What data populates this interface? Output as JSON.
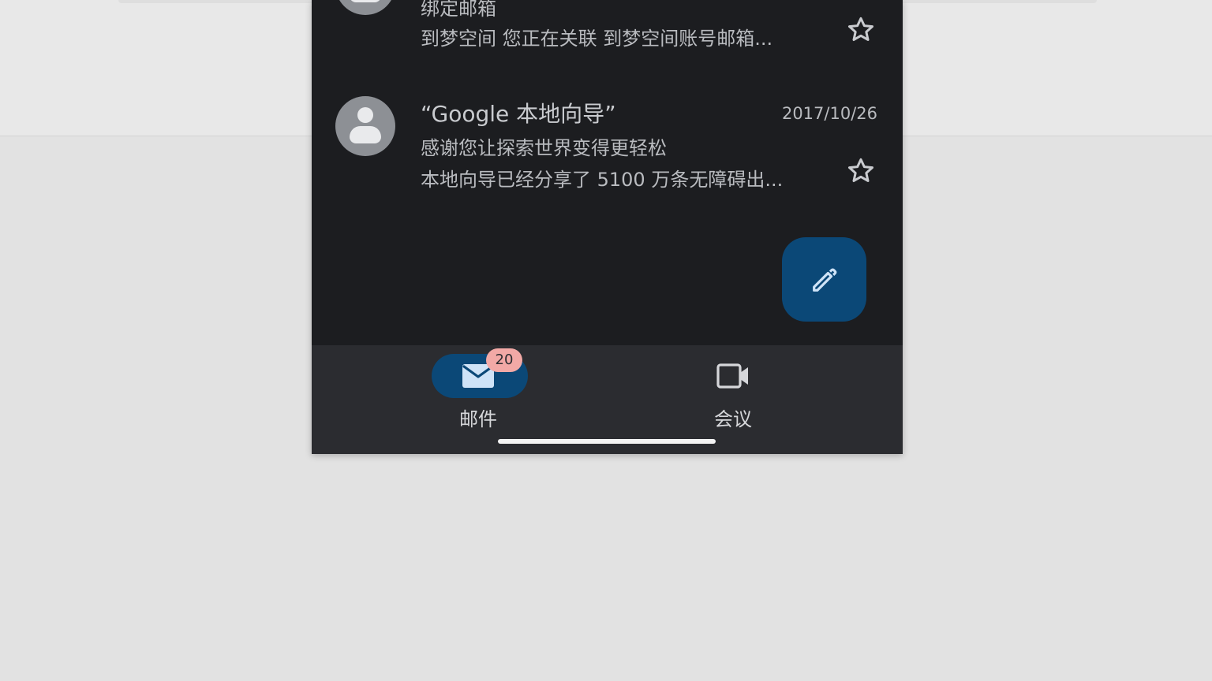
{
  "colors": {
    "page_bg": "#e2e2e2",
    "screen_bg": "#1c1d20",
    "bottom_nav_bg": "#2b2c30",
    "accent": "#0b4877",
    "badge_bg": "#f2a9a6",
    "text_primary": "#c9cbcf",
    "text_secondary": "#b9bbbf"
  },
  "emails": [
    {
      "sender": "",
      "subject": "绑定邮箱",
      "snippet": "到梦空间 您正在关联 到梦空间账号邮箱...",
      "date": "",
      "starred": false,
      "avatar_icon": "person-icon",
      "star_icon": "star-outline-icon"
    },
    {
      "sender": "“Google 本地向导”",
      "subject": "感谢您让探索世界变得更轻松",
      "snippet": "本地向导已经分享了 5100 万条无障碍出...",
      "date": "2017/10/26",
      "starred": false,
      "avatar_icon": "person-icon",
      "star_icon": "star-outline-icon"
    }
  ],
  "compose_fab": {
    "icon": "pencil-icon"
  },
  "bottom_nav": {
    "items": [
      {
        "label": "邮件",
        "icon": "mail-icon",
        "badge": "20",
        "active": true
      },
      {
        "label": "会议",
        "icon": "video-camera-icon",
        "badge": "",
        "active": false
      }
    ]
  }
}
